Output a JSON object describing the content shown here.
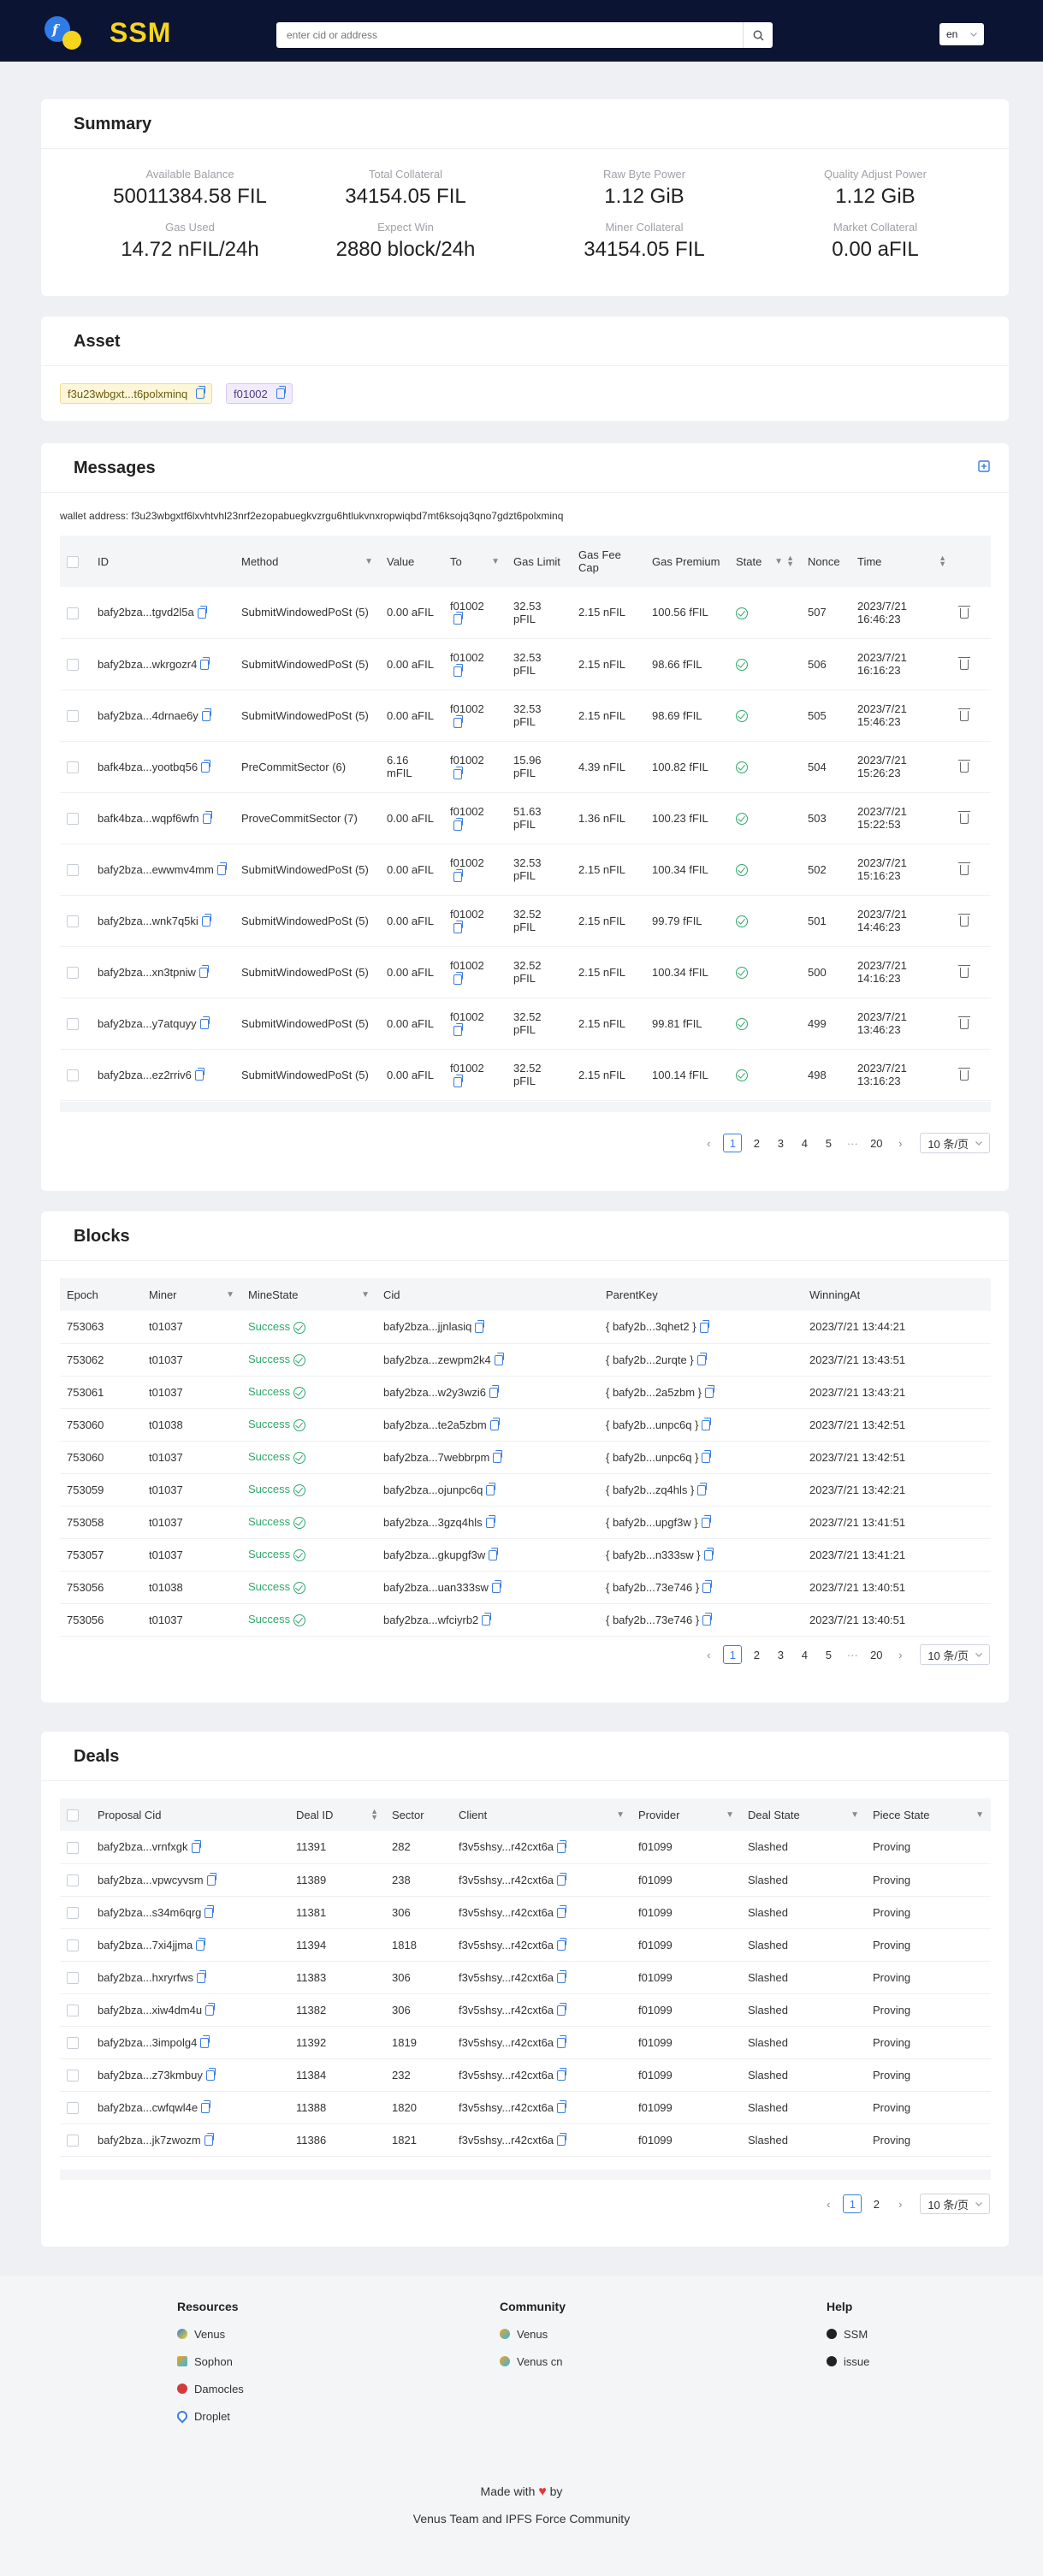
{
  "header": {
    "brand": "SSM",
    "search_placeholder": "enter cid or address",
    "lang": "en",
    "brand_color": "#f7d51e"
  },
  "summary": {
    "title": "Summary",
    "items": [
      {
        "label": "Available Balance",
        "value": "50011384.58 FIL"
      },
      {
        "label": "Total Collateral",
        "value": "34154.05 FIL"
      },
      {
        "label": "Raw Byte Power",
        "value": "1.12 GiB"
      },
      {
        "label": "Quality Adjust Power",
        "value": "1.12 GiB"
      },
      {
        "label": "Gas Used",
        "value": "14.72 nFIL/24h"
      },
      {
        "label": "Expect Win",
        "value": "2880 block/24h"
      },
      {
        "label": "Miner Collateral",
        "value": "34154.05 FIL"
      },
      {
        "label": "Market Collateral",
        "value": "0.00 aFIL"
      }
    ]
  },
  "asset": {
    "title": "Asset",
    "tags": [
      "f3u23wbgxt...t6polxminq",
      "f01002"
    ]
  },
  "messages": {
    "title": "Messages",
    "wallet_address": "wallet address: f3u23wbgxtf6lxvhtvhl23nrf2ezopabuegkvzrgu6htlukvnxropwiqbd7mt6ksojq3qno7gdzt6polxminq",
    "columns": [
      "ID",
      "Method",
      "Value",
      "To",
      "Gas Limit",
      "Gas Fee Cap",
      "Gas Premium",
      "State",
      "Nonce",
      "Time"
    ],
    "rows": [
      {
        "id": "bafy2bza...tgvd2l5a",
        "method": "SubmitWindowedPoSt (5)",
        "value": "0.00 aFIL",
        "to": "f01002",
        "gas_limit": "32.53 pFIL",
        "fee_cap": "2.15 nFIL",
        "premium": "100.56 fFIL",
        "nonce": "507",
        "time": "2023/7/21 16:46:23"
      },
      {
        "id": "bafy2bza...wkrgozr4",
        "method": "SubmitWindowedPoSt (5)",
        "value": "0.00 aFIL",
        "to": "f01002",
        "gas_limit": "32.53 pFIL",
        "fee_cap": "2.15 nFIL",
        "premium": "98.66 fFIL",
        "nonce": "506",
        "time": "2023/7/21 16:16:23"
      },
      {
        "id": "bafy2bza...4drnae6y",
        "method": "SubmitWindowedPoSt (5)",
        "value": "0.00 aFIL",
        "to": "f01002",
        "gas_limit": "32.53 pFIL",
        "fee_cap": "2.15 nFIL",
        "premium": "98.69 fFIL",
        "nonce": "505",
        "time": "2023/7/21 15:46:23"
      },
      {
        "id": "bafk4bza...yootbq56",
        "method": "PreCommitSector (6)",
        "value": "6.16 mFIL",
        "to": "f01002",
        "gas_limit": "15.96 pFIL",
        "fee_cap": "4.39 nFIL",
        "premium": "100.82 fFIL",
        "nonce": "504",
        "time": "2023/7/21 15:26:23"
      },
      {
        "id": "bafk4bza...wqpf6wfn",
        "method": "ProveCommitSector (7)",
        "value": "0.00 aFIL",
        "to": "f01002",
        "gas_limit": "51.63 pFIL",
        "fee_cap": "1.36 nFIL",
        "premium": "100.23 fFIL",
        "nonce": "503",
        "time": "2023/7/21 15:22:53"
      },
      {
        "id": "bafy2bza...ewwmv4mm",
        "method": "SubmitWindowedPoSt (5)",
        "value": "0.00 aFIL",
        "to": "f01002",
        "gas_limit": "32.53 pFIL",
        "fee_cap": "2.15 nFIL",
        "premium": "100.34 fFIL",
        "nonce": "502",
        "time": "2023/7/21 15:16:23"
      },
      {
        "id": "bafy2bza...wnk7q5ki",
        "method": "SubmitWindowedPoSt (5)",
        "value": "0.00 aFIL",
        "to": "f01002",
        "gas_limit": "32.52 pFIL",
        "fee_cap": "2.15 nFIL",
        "premium": "99.79 fFIL",
        "nonce": "501",
        "time": "2023/7/21 14:46:23"
      },
      {
        "id": "bafy2bza...xn3tpniw",
        "method": "SubmitWindowedPoSt (5)",
        "value": "0.00 aFIL",
        "to": "f01002",
        "gas_limit": "32.52 pFIL",
        "fee_cap": "2.15 nFIL",
        "premium": "100.34 fFIL",
        "nonce": "500",
        "time": "2023/7/21 14:16:23"
      },
      {
        "id": "bafy2bza...y7atquyy",
        "method": "SubmitWindowedPoSt (5)",
        "value": "0.00 aFIL",
        "to": "f01002",
        "gas_limit": "32.52 pFIL",
        "fee_cap": "2.15 nFIL",
        "premium": "99.81 fFIL",
        "nonce": "499",
        "time": "2023/7/21 13:46:23"
      },
      {
        "id": "bafy2bza...ez2rriv6",
        "method": "SubmitWindowedPoSt (5)",
        "value": "0.00 aFIL",
        "to": "f01002",
        "gas_limit": "32.52 pFIL",
        "fee_cap": "2.15 nFIL",
        "premium": "100.14 fFIL",
        "nonce": "498",
        "time": "2023/7/21 13:16:23"
      }
    ],
    "pager": {
      "pages": [
        "1",
        "2",
        "3",
        "4",
        "5"
      ],
      "ellipsis": "···",
      "last": "20",
      "size": "10 条/页"
    }
  },
  "blocks": {
    "title": "Blocks",
    "columns": [
      "Epoch",
      "Miner",
      "MineState",
      "Cid",
      "ParentKey",
      "WinningAt"
    ],
    "rows": [
      {
        "epoch": "753063",
        "miner": "t01037",
        "state": "Success",
        "cid": "bafy2bza...jjnlasiq",
        "parent": "{ bafy2b...3qhet2 }",
        "at": "2023/7/21 13:44:21"
      },
      {
        "epoch": "753062",
        "miner": "t01037",
        "state": "Success",
        "cid": "bafy2bza...zewpm2k4",
        "parent": "{ bafy2b...2urqte }",
        "at": "2023/7/21 13:43:51"
      },
      {
        "epoch": "753061",
        "miner": "t01037",
        "state": "Success",
        "cid": "bafy2bza...w2y3wzi6",
        "parent": "{ bafy2b...2a5zbm }",
        "at": "2023/7/21 13:43:21"
      },
      {
        "epoch": "753060",
        "miner": "t01038",
        "state": "Success",
        "cid": "bafy2bza...te2a5zbm",
        "parent": "{ bafy2b...unpc6q }",
        "at": "2023/7/21 13:42:51"
      },
      {
        "epoch": "753060",
        "miner": "t01037",
        "state": "Success",
        "cid": "bafy2bza...7webbrpm",
        "parent": "{ bafy2b...unpc6q }",
        "at": "2023/7/21 13:42:51"
      },
      {
        "epoch": "753059",
        "miner": "t01037",
        "state": "Success",
        "cid": "bafy2bza...ojunpc6q",
        "parent": "{ bafy2b...zq4hls }",
        "at": "2023/7/21 13:42:21"
      },
      {
        "epoch": "753058",
        "miner": "t01037",
        "state": "Success",
        "cid": "bafy2bza...3gzq4hls",
        "parent": "{ bafy2b...upgf3w }",
        "at": "2023/7/21 13:41:51"
      },
      {
        "epoch": "753057",
        "miner": "t01037",
        "state": "Success",
        "cid": "bafy2bza...gkupgf3w",
        "parent": "{ bafy2b...n333sw }",
        "at": "2023/7/21 13:41:21"
      },
      {
        "epoch": "753056",
        "miner": "t01038",
        "state": "Success",
        "cid": "bafy2bza...uan333sw",
        "parent": "{ bafy2b...73e746 }",
        "at": "2023/7/21 13:40:51"
      },
      {
        "epoch": "753056",
        "miner": "t01037",
        "state": "Success",
        "cid": "bafy2bza...wfciyrb2",
        "parent": "{ bafy2b...73e746 }",
        "at": "2023/7/21 13:40:51"
      }
    ],
    "pager": {
      "pages": [
        "1",
        "2",
        "3",
        "4",
        "5"
      ],
      "ellipsis": "···",
      "last": "20",
      "size": "10 条/页"
    }
  },
  "deals": {
    "title": "Deals",
    "columns": [
      "Proposal Cid",
      "Deal ID",
      "Sector",
      "Client",
      "Provider",
      "Deal State",
      "Piece State"
    ],
    "rows": [
      {
        "cid": "bafy2bza...vrnfxgk",
        "id": "11391",
        "sector": "282",
        "client": "f3v5shsy...r42cxt6a",
        "provider": "f01099",
        "dstate": "Slashed",
        "pstate": "Proving"
      },
      {
        "cid": "bafy2bza...vpwcyvsm",
        "id": "11389",
        "sector": "238",
        "client": "f3v5shsy...r42cxt6a",
        "provider": "f01099",
        "dstate": "Slashed",
        "pstate": "Proving"
      },
      {
        "cid": "bafy2bza...s34m6qrg",
        "id": "11381",
        "sector": "306",
        "client": "f3v5shsy...r42cxt6a",
        "provider": "f01099",
        "dstate": "Slashed",
        "pstate": "Proving"
      },
      {
        "cid": "bafy2bza...7xi4jjma",
        "id": "11394",
        "sector": "1818",
        "client": "f3v5shsy...r42cxt6a",
        "provider": "f01099",
        "dstate": "Slashed",
        "pstate": "Proving"
      },
      {
        "cid": "bafy2bza...hxryrfws",
        "id": "11383",
        "sector": "306",
        "client": "f3v5shsy...r42cxt6a",
        "provider": "f01099",
        "dstate": "Slashed",
        "pstate": "Proving"
      },
      {
        "cid": "bafy2bza...xiw4dm4u",
        "id": "11382",
        "sector": "306",
        "client": "f3v5shsy...r42cxt6a",
        "provider": "f01099",
        "dstate": "Slashed",
        "pstate": "Proving"
      },
      {
        "cid": "bafy2bza...3impolg4",
        "id": "11392",
        "sector": "1819",
        "client": "f3v5shsy...r42cxt6a",
        "provider": "f01099",
        "dstate": "Slashed",
        "pstate": "Proving"
      },
      {
        "cid": "bafy2bza...z73kmbuy",
        "id": "11384",
        "sector": "232",
        "client": "f3v5shsy...r42cxt6a",
        "provider": "f01099",
        "dstate": "Slashed",
        "pstate": "Proving"
      },
      {
        "cid": "bafy2bza...cwfqwl4e",
        "id": "11388",
        "sector": "1820",
        "client": "f3v5shsy...r42cxt6a",
        "provider": "f01099",
        "dstate": "Slashed",
        "pstate": "Proving"
      },
      {
        "cid": "bafy2bza...jk7zwozm",
        "id": "11386",
        "sector": "1821",
        "client": "f3v5shsy...r42cxt6a",
        "provider": "f01099",
        "dstate": "Slashed",
        "pstate": "Proving"
      }
    ],
    "pager": {
      "pages": [
        "1",
        "2"
      ],
      "size": "10 条/页"
    }
  },
  "footer": {
    "resources": {
      "title": "Resources",
      "items": [
        "Venus",
        "Sophon",
        "Damocles",
        "Droplet"
      ]
    },
    "community": {
      "title": "Community",
      "items": [
        "Venus",
        "Venus cn"
      ]
    },
    "help": {
      "title": "Help",
      "items": [
        "SSM",
        "issue"
      ]
    },
    "made_prefix": "Made with",
    "made_suffix": "by",
    "team": "Venus Team and IPFS Force Community"
  }
}
